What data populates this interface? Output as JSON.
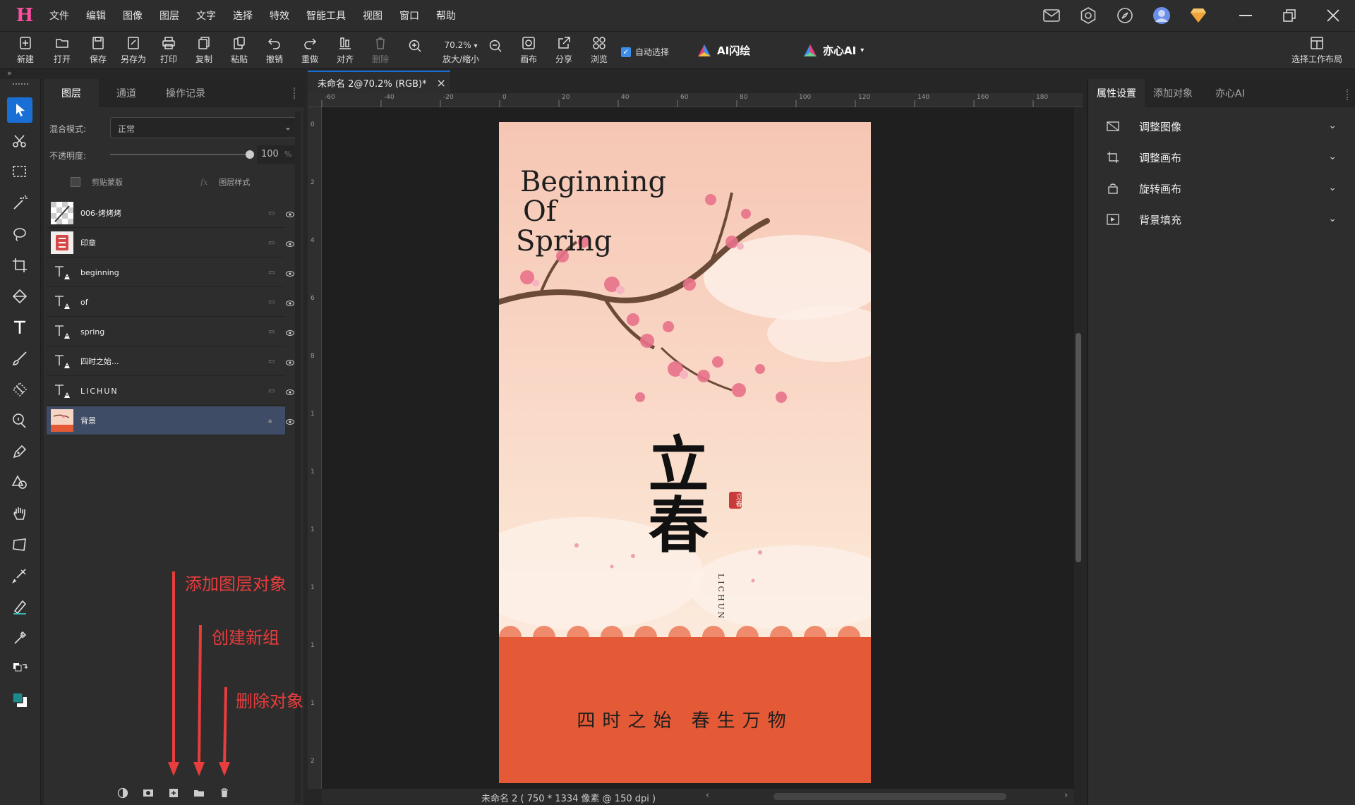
{
  "menu": {
    "logo": "H",
    "items": [
      "文件",
      "编辑",
      "图像",
      "图层",
      "文字",
      "选择",
      "特效",
      "智能工具",
      "视图",
      "窗口",
      "帮助"
    ]
  },
  "toolbar": {
    "new": "新建",
    "open": "打开",
    "save": "保存",
    "save_as": "另存为",
    "print": "打印",
    "copy": "复制",
    "paste": "粘贴",
    "undo": "撤销",
    "redo": "重做",
    "align": "对齐",
    "delete": "删除",
    "zoom_value": "70.2%",
    "zoom_label": "放大/缩小",
    "canvas": "画布",
    "share": "分享",
    "browse": "浏览",
    "auto_select": "自动选择",
    "ai_paint": "AI闪绘",
    "yixin_ai": "亦心AI",
    "layout": "选择工作布局"
  },
  "layers_panel": {
    "tabs": [
      "图层",
      "通道",
      "操作记录"
    ],
    "blend_label": "混合模式:",
    "blend_value": "正常",
    "opacity_label": "不透明度:",
    "opacity_value": "100",
    "opacity_unit": "%",
    "clip_mask": "剪贴蒙版",
    "layer_style": "图层样式",
    "layers": [
      {
        "name": "006-烤烤烤",
        "type": "image"
      },
      {
        "name": "印章",
        "type": "image"
      },
      {
        "name": "beginning",
        "type": "text"
      },
      {
        "name": "of",
        "type": "text"
      },
      {
        "name": "spring",
        "type": "text"
      },
      {
        "name": "四时之始...",
        "type": "text"
      },
      {
        "name": "LICHUN",
        "type": "text"
      },
      {
        "name": "背景",
        "type": "image",
        "selected": true
      }
    ]
  },
  "annotations": {
    "add_layer": "添加图层对象",
    "new_group": "创建新组",
    "delete": "删除对象"
  },
  "document": {
    "tab_title": "未命名 2@70.2% (RGB)*",
    "status": "未命名 2 ( 750 * 1334 像素 @ 150 dpi )",
    "ruler_h": [
      "-60",
      "-40",
      "-20",
      "0",
      "20",
      "40",
      "60",
      "80",
      "100",
      "120",
      "140",
      "160",
      "180"
    ],
    "ruler_v": [
      "0",
      "2",
      "4",
      "6",
      "8",
      "1",
      "1",
      "1",
      "1",
      "1",
      "1",
      "2"
    ]
  },
  "poster": {
    "title_lines": [
      "Beginning",
      "Of",
      "Spring"
    ],
    "calligraphy": "立春",
    "seal": "立春",
    "lichun": "LICHUN",
    "slogan": "四时之始 春生万物"
  },
  "right_panel": {
    "tabs": [
      "属性设置",
      "添加对象",
      "亦心AI"
    ],
    "items": [
      "调整图像",
      "调整画布",
      "旋转画布",
      "背景填充"
    ]
  }
}
